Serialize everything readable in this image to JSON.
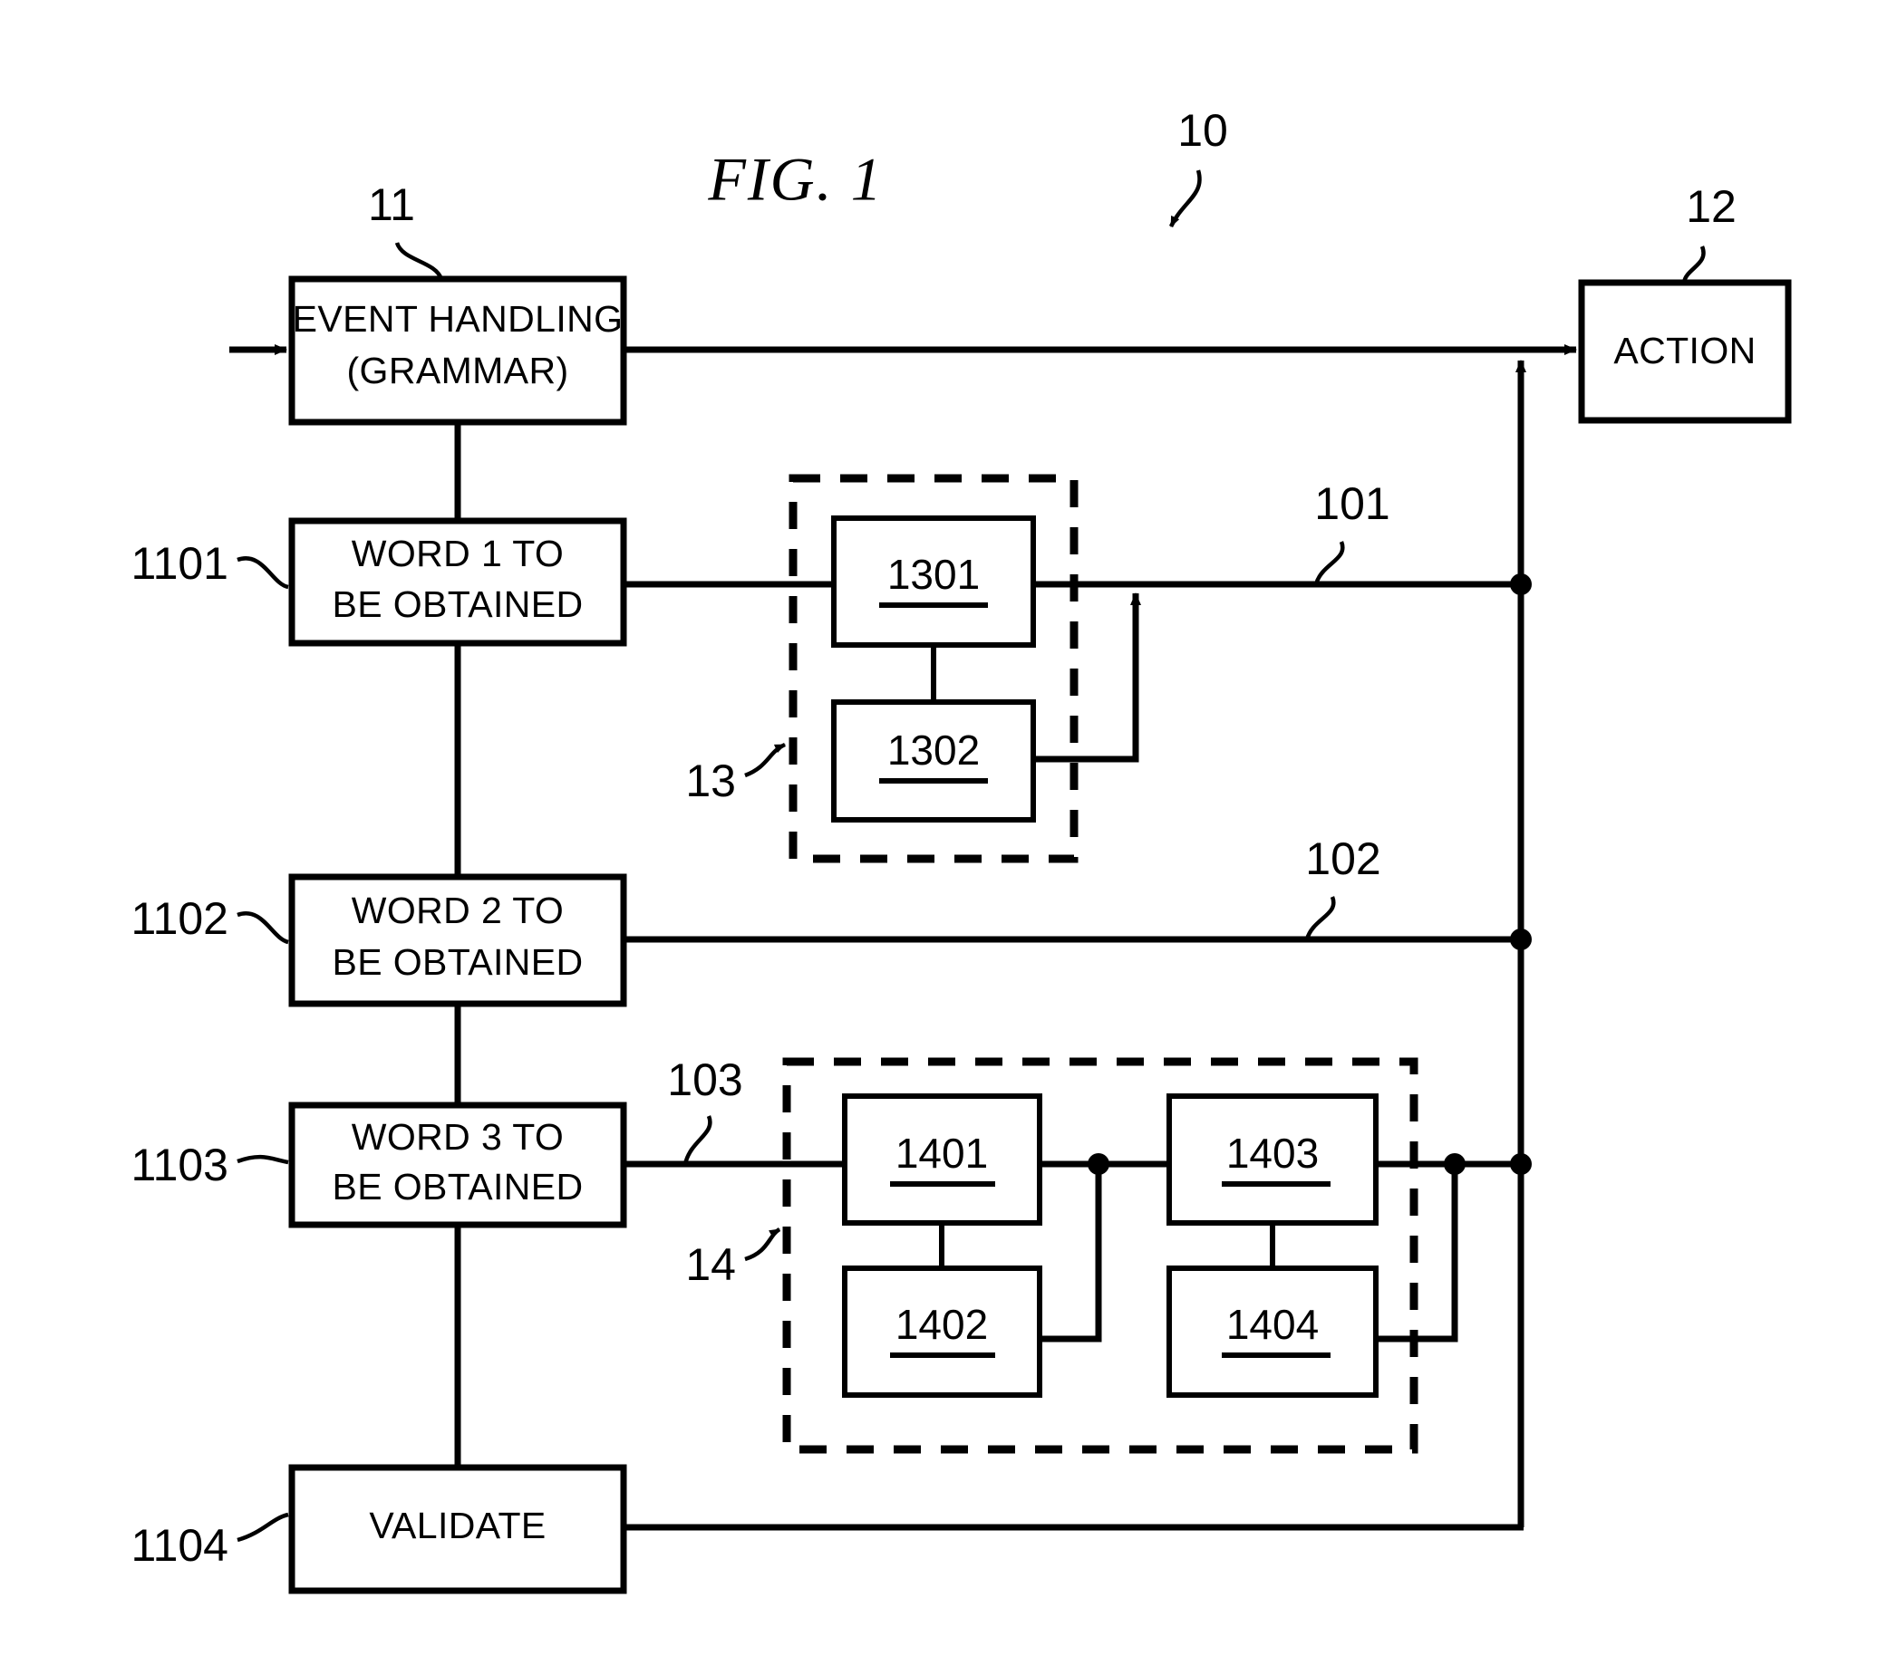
{
  "figure": {
    "title": "FIG. 1",
    "system_ref": "10"
  },
  "blocks": {
    "event_handling": {
      "line1": "EVENT HANDLING",
      "line2": "(GRAMMAR)",
      "ref": "11"
    },
    "action": {
      "label": "ACTION",
      "ref": "12"
    },
    "word1": {
      "line1": "WORD 1 TO",
      "line2": "BE OBTAINED",
      "ref": "1101"
    },
    "word2": {
      "line1": "WORD 2 TO",
      "line2": "BE OBTAINED",
      "ref": "1102"
    },
    "word3": {
      "line1": "WORD 3 TO",
      "line2": "BE OBTAINED",
      "ref": "1103"
    },
    "validate": {
      "label": "VALIDATE",
      "ref": "1104"
    }
  },
  "groups": {
    "group_13": {
      "ref": "13",
      "members": [
        {
          "label": "1301"
        },
        {
          "label": "1302"
        }
      ]
    },
    "group_14": {
      "ref": "14",
      "members": [
        {
          "label": "1401"
        },
        {
          "label": "1402"
        },
        {
          "label": "1403"
        },
        {
          "label": "1404"
        }
      ]
    }
  },
  "signals": {
    "s101": "101",
    "s102": "102",
    "s103": "103"
  },
  "colors": {
    "ink": "#000000",
    "paper": "#ffffff"
  }
}
